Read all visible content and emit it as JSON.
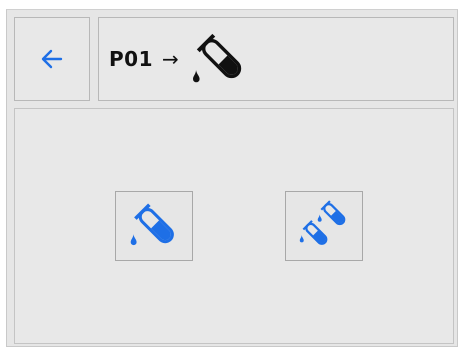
{
  "header": {
    "title": "P01",
    "arrow": "→",
    "title_icon": "test-tube-pour-icon"
  },
  "back_button": {
    "icon": "arrow-left-icon"
  },
  "tools": [
    {
      "name": "single-pour-button",
      "icon": "test-tube-pour-icon"
    },
    {
      "name": "multi-pour-button",
      "icon": "test-tubes-multiple-icon"
    }
  ],
  "colors": {
    "accent": "#1e6fe6",
    "icon_dark": "#111111",
    "panel_bg": "#e8e8e8",
    "border": "#b8b8b8"
  }
}
